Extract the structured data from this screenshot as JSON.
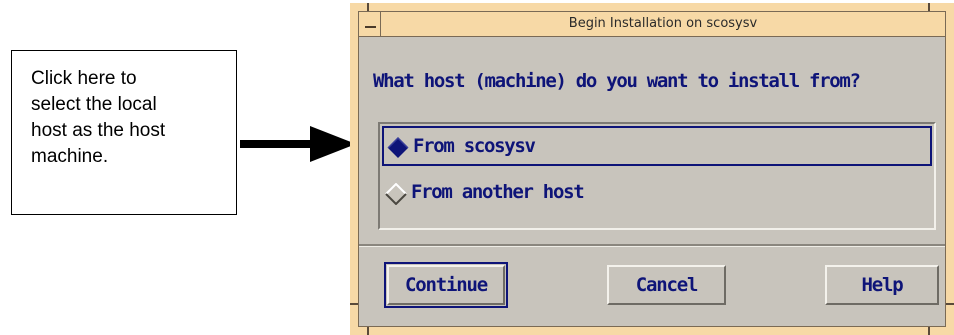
{
  "callout": {
    "lines": [
      "Click here to",
      "select the local",
      "host as the host",
      "machine."
    ]
  },
  "window": {
    "title": "Begin Installation on scosysv",
    "question": "What host (machine) do you want to install from?",
    "options": [
      {
        "label": "From scosysv",
        "selected": true
      },
      {
        "label": "From another host",
        "selected": false
      }
    ],
    "buttons": {
      "continue": "Continue",
      "cancel": "Cancel",
      "help": "Help"
    }
  },
  "colors": {
    "frame": "#f7d9a6",
    "dialog_bg": "#c8c4bc",
    "text_navy": "#0e1478"
  }
}
